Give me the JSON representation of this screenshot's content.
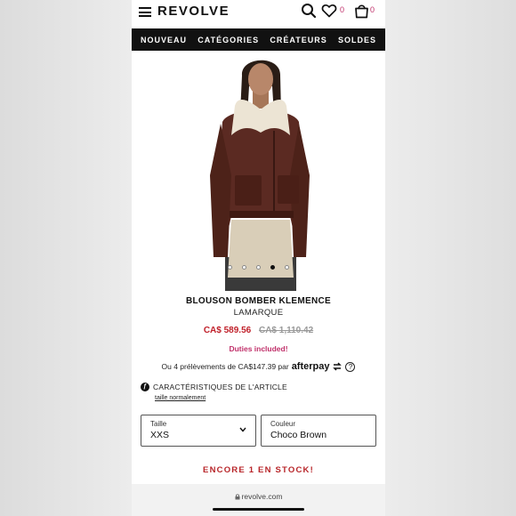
{
  "header": {
    "logo": "REVOLVE",
    "wishlist_count": "0",
    "bag_count": "0"
  },
  "nav": {
    "items": [
      "NOUVEAU",
      "CATÉGORIES",
      "CRÉATEURS",
      "SOLDES"
    ]
  },
  "gallery": {
    "image_count": 5,
    "active_index": 3
  },
  "product": {
    "title": "BLOUSON BOMBER KLEMENCE",
    "brand": "LAMARQUE",
    "sale_price": "CA$ 589.56",
    "original_price": "CA$ 1,110.42",
    "duties": "Duties included!",
    "afterpay_text": "Ou 4 prélèvements de CA$147.39 par",
    "afterpay_brand": "afterpay",
    "features_label": "CARACTÉRISTIQUES DE L'ARTICLE",
    "fit_link": "taille normalement",
    "stock_message": "ENCORE 1 EN STOCK!"
  },
  "selectors": {
    "size_label": "Taille",
    "size_value": "XXS",
    "color_label": "Couleur",
    "color_value": "Choco Brown"
  },
  "browser": {
    "url": "revolve.com"
  },
  "colors": {
    "sale_red": "#c0202a",
    "accent_pink": "#c0306a",
    "nav_bg": "#111111"
  }
}
